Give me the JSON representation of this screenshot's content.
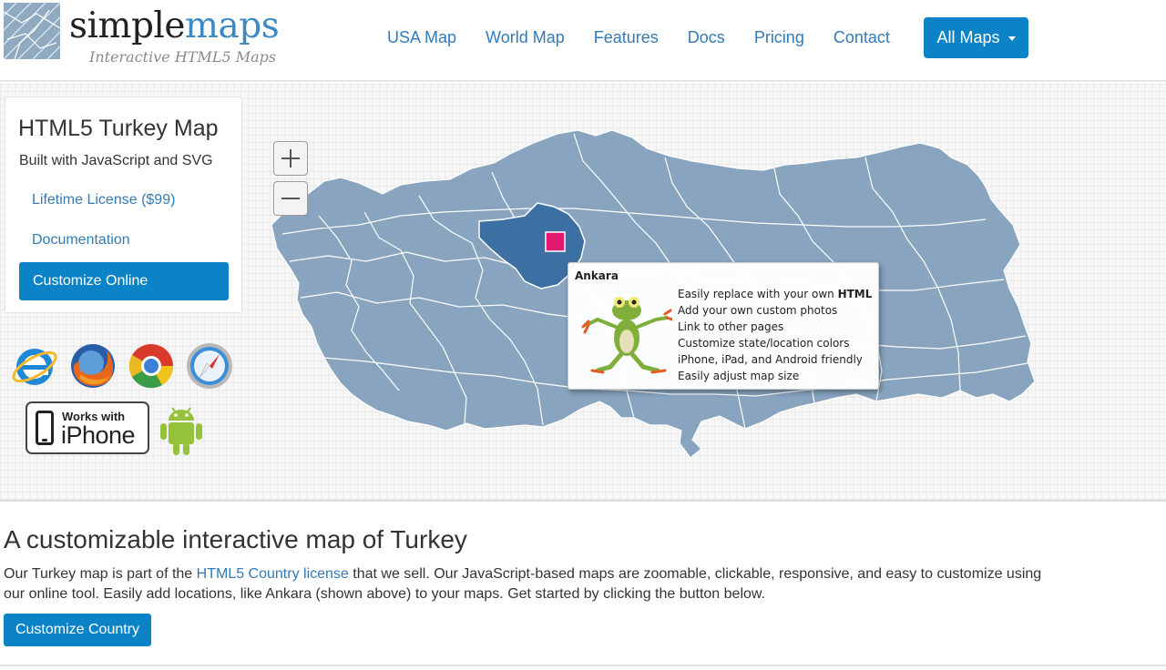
{
  "header": {
    "logo": {
      "word_dark": "simple",
      "word_accent": "maps",
      "tagline": "Interactive HTML5 Maps"
    },
    "nav": [
      {
        "label": "USA Map"
      },
      {
        "label": "World Map"
      },
      {
        "label": "Features"
      },
      {
        "label": "Docs"
      },
      {
        "label": "Pricing"
      },
      {
        "label": "Contact"
      }
    ],
    "all_maps_label": "All Maps"
  },
  "sidebar": {
    "title": "HTML5 Turkey Map",
    "subtitle": "Built with JavaScript and SVG",
    "links": [
      {
        "label": "Lifetime License ($99)"
      },
      {
        "label": "Documentation"
      }
    ],
    "customize_button": "Customize Online",
    "browser_icons": [
      "internet-explorer-icon",
      "firefox-icon",
      "chrome-icon",
      "safari-icon"
    ],
    "iphone_badge": {
      "line1": "Works with",
      "line2": "iPhone"
    },
    "android_icon": "android-icon"
  },
  "map": {
    "highlighted_region": "Ankara",
    "colors": {
      "region": "#88a4bf",
      "region_highlight": "#3d70a2",
      "border": "#ffffff",
      "marker": "#e0196f"
    },
    "tooltip": {
      "title": "Ankara",
      "features_prefix": "Easily replace with your own ",
      "features_bold": "HTML",
      "features": [
        "Add your own custom photos",
        "Link to other pages",
        "Customize state/location colors",
        "iPhone, iPad, and Android friendly",
        "Easily adjust map size"
      ]
    }
  },
  "content": {
    "heading": "A customizable interactive map of Turkey",
    "para_before_link": "Our Turkey map is part of the ",
    "para_link": "HTML5 Country license",
    "para_after_link": " that we sell. Our JavaScript-based maps are zoomable, clickable, responsive, and easy to customize using our online tool. Easily add locations, like Ankara (shown above) to your maps. Get started by clicking the button below.",
    "button": "Customize Country"
  },
  "colors": {
    "accent": "#0c83c6",
    "link": "#337ab7"
  }
}
